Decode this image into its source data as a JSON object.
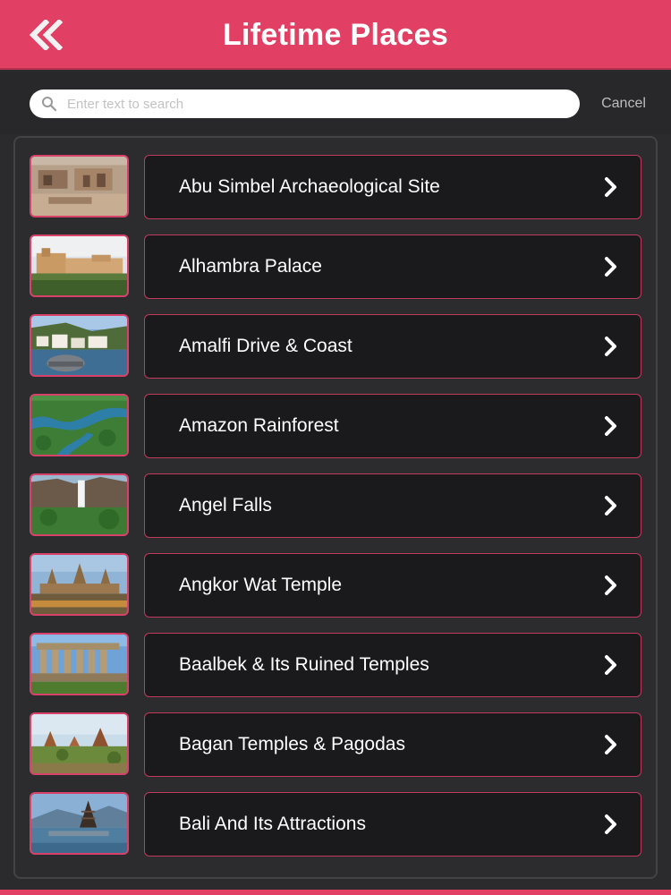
{
  "header": {
    "title": "Lifetime Places",
    "back_icon": "double-chevron-left-icon"
  },
  "search": {
    "placeholder": "Enter text to search",
    "value": "",
    "cancel_label": "Cancel"
  },
  "colors": {
    "accent": "#e13f63",
    "background": "#2b2b2d",
    "card": "#1a1a1c",
    "card_border": "#c03a5d"
  },
  "places": [
    {
      "label": "Abu Simbel Archaeological Site",
      "icon": "chevron-right-icon"
    },
    {
      "label": "Alhambra Palace",
      "icon": "chevron-right-icon"
    },
    {
      "label": "Amalfi Drive & Coast",
      "icon": "chevron-right-icon"
    },
    {
      "label": "Amazon Rainforest",
      "icon": "chevron-right-icon"
    },
    {
      "label": "Angel Falls",
      "icon": "chevron-right-icon"
    },
    {
      "label": "Angkor Wat Temple",
      "icon": "chevron-right-icon"
    },
    {
      "label": "Baalbek & Its Ruined Temples",
      "icon": "chevron-right-icon"
    },
    {
      "label": "Bagan Temples & Pagodas",
      "icon": "chevron-right-icon"
    },
    {
      "label": "Bali And Its Attractions",
      "icon": "chevron-right-icon"
    }
  ]
}
